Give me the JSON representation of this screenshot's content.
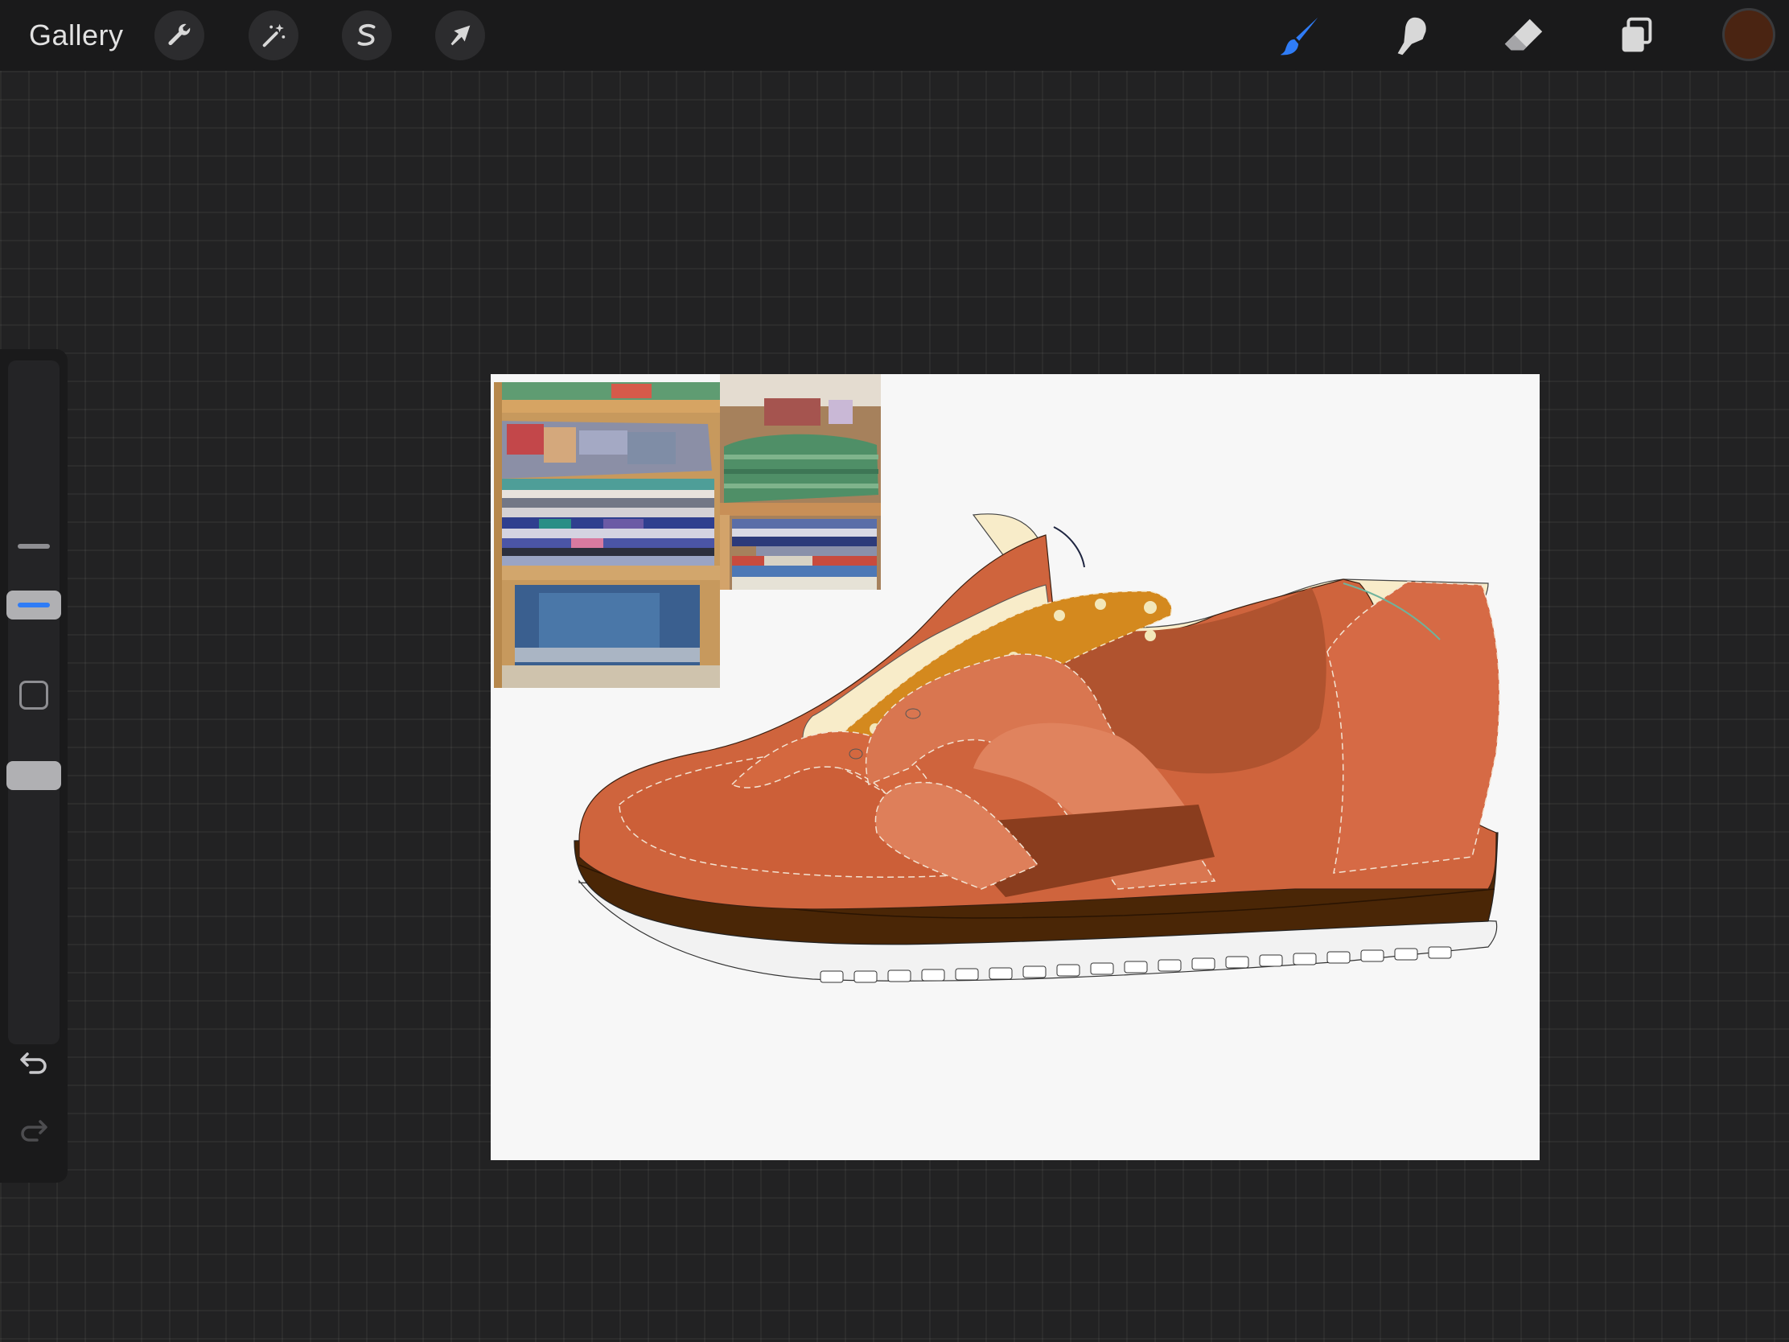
{
  "topbar": {
    "gallery_label": "Gallery",
    "tools_left": [
      {
        "name": "actions",
        "icon": "wrench-icon"
      },
      {
        "name": "adjustments",
        "icon": "magic-wand-icon"
      },
      {
        "name": "selection",
        "icon": "selection-s-icon"
      },
      {
        "name": "transform",
        "icon": "arrow-cursor-icon"
      }
    ],
    "tools_right": [
      {
        "name": "brush",
        "icon": "brush-icon",
        "active": true,
        "active_color": "#2f7cf6"
      },
      {
        "name": "smudge",
        "icon": "smudge-finger-icon"
      },
      {
        "name": "eraser",
        "icon": "eraser-icon"
      },
      {
        "name": "layers",
        "icon": "layers-icon"
      }
    ],
    "current_color": "#4a2412"
  },
  "sidebar": {
    "brush_size_icon": "size-slider-icon",
    "modify_icon": "square-modify-icon",
    "undo_icon": "undo-arrow-icon",
    "redo_icon": "redo-arrow-icon"
  },
  "canvas": {
    "background": "#f7f7f7",
    "content": "shoe-drawing-with-reference-photos",
    "palette": {
      "upper": "#cf643d",
      "panel_light": "#df7c59",
      "panel_dark": "#b0532f",
      "eyelet_stay": "#d4891e",
      "collar": "#f8ecc9",
      "midsole": "#4a2606",
      "heel_stripe": "#8a3d1e"
    }
  }
}
